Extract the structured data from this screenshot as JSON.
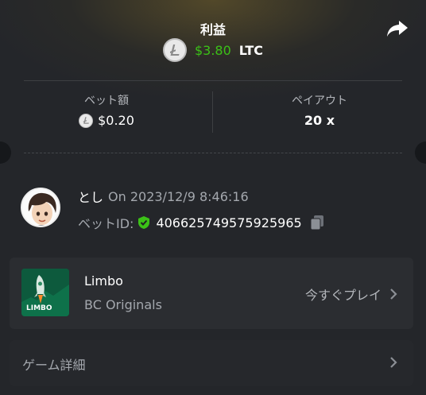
{
  "header": {
    "title": "利益",
    "profit_amount": "$3.80",
    "profit_currency": "LTC",
    "share_icon": "share-arrow-icon",
    "coin_icon": "litecoin-icon"
  },
  "stats": {
    "bet_amount_label": "ベット額",
    "bet_amount_value": "$0.20",
    "payout_label": "ペイアウト",
    "payout_value": "20 x"
  },
  "user": {
    "name": "とし",
    "date": "On 2023/12/9 8:46:16",
    "bet_id_label": "ベットID:",
    "bet_id": "406625749575925965"
  },
  "game": {
    "name": "Limbo",
    "provider": "BC Originals",
    "play_label": "今すぐプレイ",
    "thumb_text": "LIMBO"
  },
  "details": {
    "label": "ゲーム詳細"
  },
  "colors": {
    "accent_green": "#3bc117",
    "background": "#24262a"
  }
}
